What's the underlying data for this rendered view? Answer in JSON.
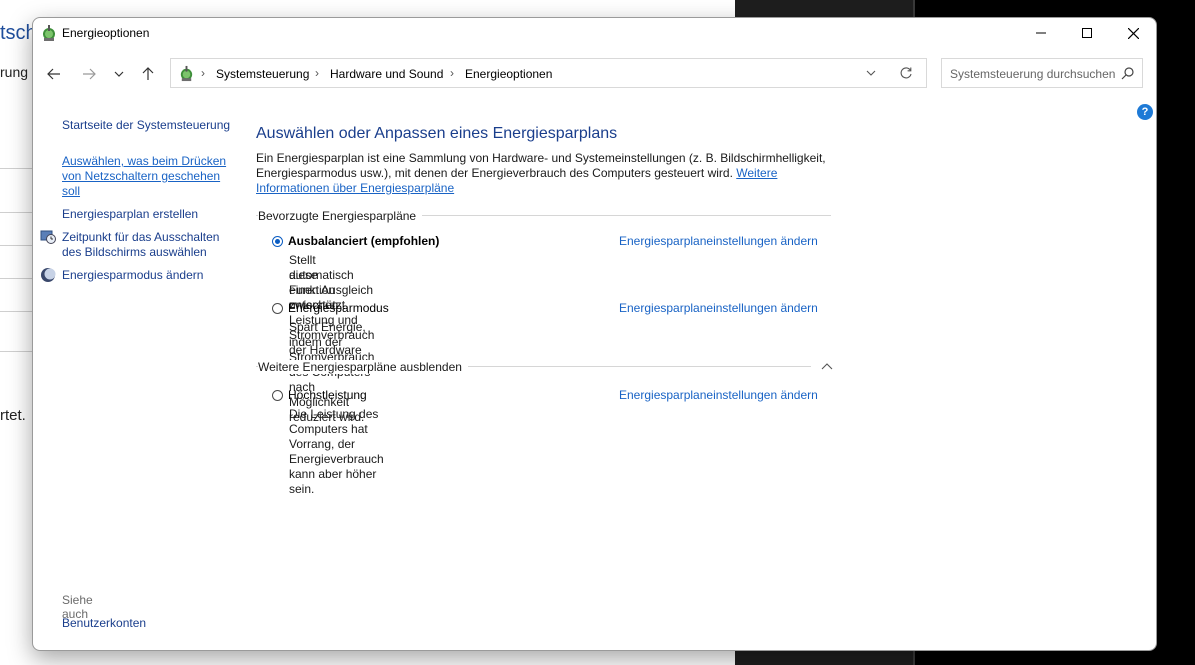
{
  "background": {
    "fragment_title": "tsch",
    "fragment_line1": "rung",
    "fragment_line2": "rtet."
  },
  "window": {
    "title": "Energieoptionen"
  },
  "address": {
    "crumbs": [
      "Systemsteuerung",
      "Hardware und Sound",
      "Energieoptionen"
    ],
    "search_placeholder": "Systemsteuerung durchsuchen"
  },
  "sidebar": {
    "home": "Startseite der Systemsteuerung",
    "power_buttons_line1": "Auswählen, was beim Drücken",
    "power_buttons_line2": "von Netzschaltern geschehen",
    "power_buttons_line3": "soll",
    "create_plan": "Energiesparplan erstellen",
    "display_off_line1": "Zeitpunkt für das Ausschalten",
    "display_off_line2": "des Bildschirms auswählen",
    "sleep_mode": "Energiesparmodus ändern",
    "see_also": "Siehe auch",
    "user_accounts": "Benutzerkonten"
  },
  "main": {
    "heading": "Auswählen oder Anpassen eines Energiesparplans",
    "description": "Ein Energiesparplan ist eine Sammlung von Hardware- und Systemeinstellungen (z. B. Bildschirmhelligkeit, Energiesparmodus usw.), mit denen der Energieverbrauch des Computers gesteuert wird.",
    "more_info_link": "Weitere Informationen über Energiesparpläne",
    "preferred_label": "Bevorzugte Energiesparpläne",
    "more_plans_label": "Weitere Energiesparpläne ausblenden",
    "plans": [
      {
        "name": "Ausbalanciert (empfohlen)",
        "selected": true,
        "link": "Energiesparplaneinstellungen ändern",
        "desc_line1": "Stellt automatisch einen Ausgleich zwischen Leistung und Stromverbrauch der Hardware her, die",
        "desc_line2": "diese Funktion unterstützt."
      },
      {
        "name": "Energiesparmodus",
        "selected": false,
        "link": "Energiesparplaneinstellungen ändern",
        "desc_line1": "Spart Energie, indem der Stromverbrauch des Computers nach Möglichkeit reduziert wird."
      },
      {
        "name": "Höchstleistung",
        "selected": false,
        "link": "Energiesparplaneinstellungen ändern",
        "desc_line1": "Die Leistung des Computers hat Vorrang, der Energieverbrauch kann aber höher sein."
      }
    ]
  },
  "colors": {
    "link": "#1963c5",
    "heading": "#1a3e8c",
    "radio_selected": "#0a5cc2"
  }
}
